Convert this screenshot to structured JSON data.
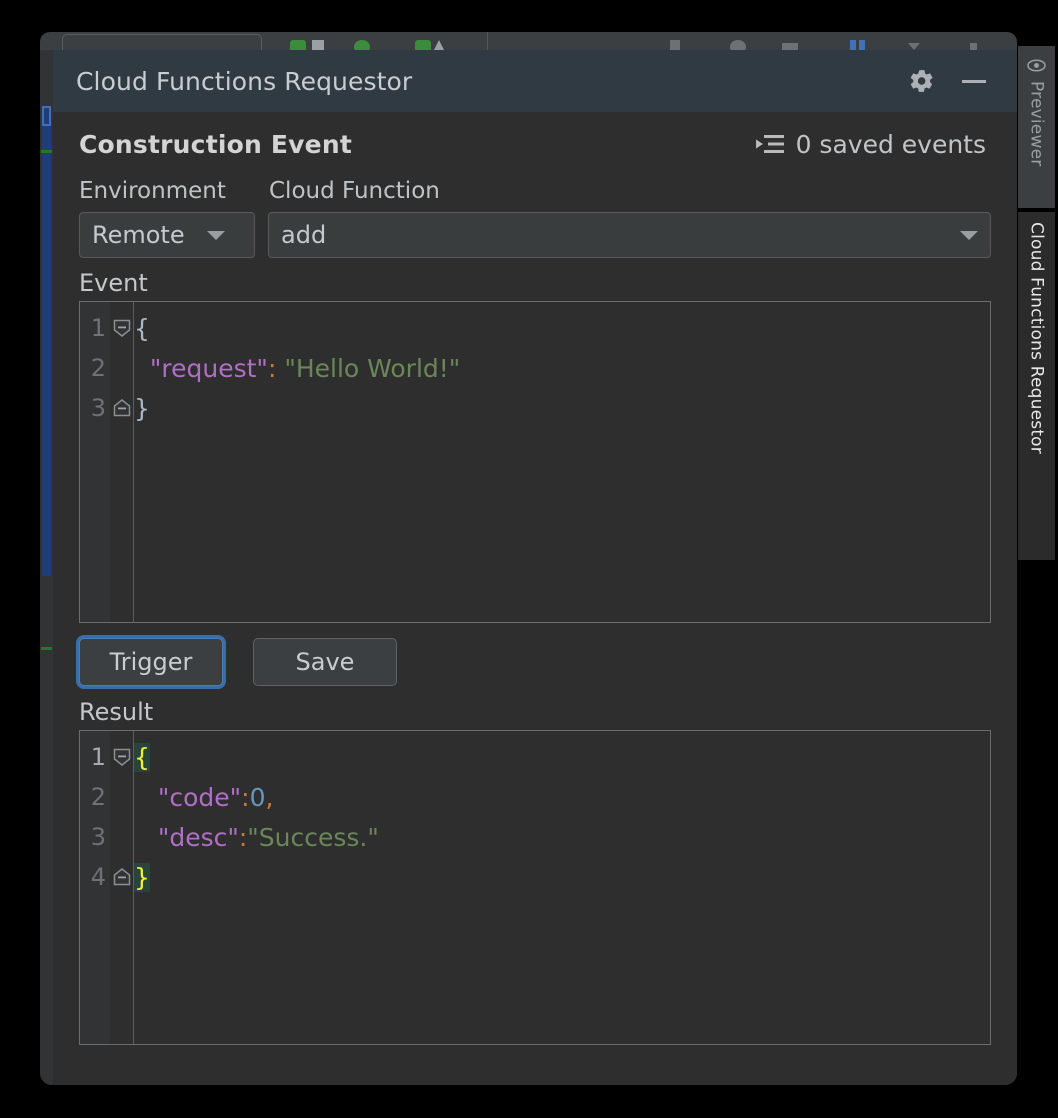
{
  "window": {
    "title": "Cloud Functions Requestor",
    "gear_icon": "gear-icon",
    "minimize_icon": "minimize-icon"
  },
  "panel": {
    "section_title": "Construction Event",
    "saved_events": {
      "icon": "collapse-list-icon",
      "text": "0 saved events",
      "count": 0
    },
    "fields": {
      "environment_label": "Environment",
      "cloud_function_label": "Cloud Function",
      "environment_value": "Remote",
      "environment_options": [
        "Remote"
      ],
      "cloud_function_value": "add",
      "cloud_function_options": [
        "add"
      ]
    },
    "event_editor": {
      "label": "Event",
      "lines": [
        {
          "number": "1",
          "fold": "collapse-start",
          "tokens": [
            {
              "t": "{",
              "c": "tok-brace"
            }
          ]
        },
        {
          "number": "2",
          "fold": "none",
          "tokens": [
            {
              "t": "  \"request\"",
              "c": "tok-key"
            },
            {
              "t": ":",
              "c": "tok-colon"
            },
            {
              "t": " \"Hello World!\"",
              "c": "tok-str"
            }
          ]
        },
        {
          "number": "3",
          "fold": "collapse-end",
          "tokens": [
            {
              "t": "}",
              "c": "tok-brace"
            }
          ]
        }
      ]
    },
    "buttons": {
      "trigger_label": "Trigger",
      "save_label": "Save"
    },
    "result_editor": {
      "label": "Result",
      "lines": [
        {
          "number": "1",
          "current": true,
          "fold": "collapse-start",
          "tokens": [
            {
              "t": "{",
              "c": "tok-brace-h"
            }
          ]
        },
        {
          "number": "2",
          "fold": "none",
          "tokens": [
            {
              "t": "   \"code\"",
              "c": "tok-key"
            },
            {
              "t": ":",
              "c": "tok-colon"
            },
            {
              "t": "0",
              "c": "tok-num"
            },
            {
              "t": ",",
              "c": "tok-comma"
            }
          ]
        },
        {
          "number": "3",
          "fold": "none",
          "tokens": [
            {
              "t": "   \"desc\"",
              "c": "tok-key"
            },
            {
              "t": ":",
              "c": "tok-colon"
            },
            {
              "t": "\"Success.\"",
              "c": "tok-str"
            }
          ]
        },
        {
          "number": "4",
          "fold": "collapse-end",
          "tokens": [
            {
              "t": "}",
              "c": "tok-brace-h"
            }
          ]
        }
      ]
    }
  },
  "right_rail": {
    "tabs": [
      {
        "label": "Previewer",
        "icon": "eye-icon",
        "active": false
      },
      {
        "label": "Cloud Functions Requestor",
        "icon": "none",
        "active": true
      }
    ]
  },
  "colors": {
    "window_chrome": "#3c3f41",
    "titlebar": "#2f3a43",
    "panel_bg": "#2e2e2e",
    "gutter": "#313335",
    "accent_focus": "#3a6ea8",
    "marker_blue": "#1f3d7a",
    "marker_green": "#1f7a2e",
    "json_key": "#b06fc6",
    "json_string": "#6a8759",
    "json_number": "#6897bb",
    "json_punct": "#cc7832",
    "brace_match": "#f2ef3b",
    "brace_match_bg": "#29443a"
  }
}
